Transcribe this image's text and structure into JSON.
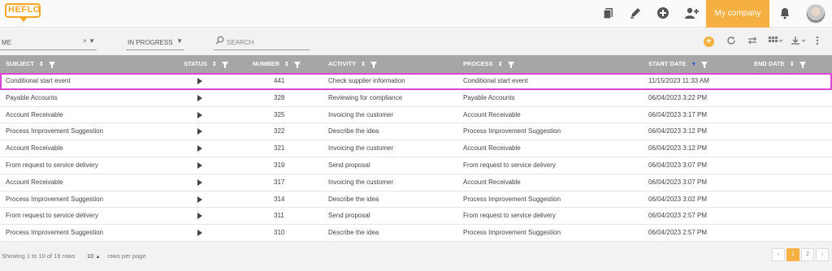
{
  "header": {
    "logo_text": "HEFLO",
    "company_label": "My company"
  },
  "filters": {
    "assignee_value": "ME",
    "assignee_clear": "×",
    "status_value": "IN PROGRESS",
    "search_placeholder": "SEARCH"
  },
  "table": {
    "columns": {
      "subject": "SUBJECT",
      "status": "STATUS",
      "number": "NUMBER",
      "activity": "ACTIVITY",
      "process": "PROCESS",
      "start_date": "START DATE",
      "end_date": "END DATE"
    },
    "rows": [
      {
        "subject": "Conditional start event",
        "number": "441",
        "activity": "Check supplier information",
        "process": "Conditional start event",
        "start_date": "11/15/2023 11:33 AM",
        "end_date": ""
      },
      {
        "subject": "Payable Accounts",
        "number": "328",
        "activity": "Reviewing for compliance",
        "process": "Payable Accounts",
        "start_date": "06/04/2023 3:22 PM",
        "end_date": ""
      },
      {
        "subject": "Account Receivable",
        "number": "325",
        "activity": "Invoicing the customer",
        "process": "Account Receivable",
        "start_date": "06/04/2023 3:17 PM",
        "end_date": ""
      },
      {
        "subject": "Process Improvement Suggestion",
        "number": "322",
        "activity": "Describe the idea",
        "process": "Process Improvement Suggestion",
        "start_date": "06/04/2023 3:12 PM",
        "end_date": ""
      },
      {
        "subject": "Account Receivable",
        "number": "321",
        "activity": "Invoicing the customer",
        "process": "Account Receivable",
        "start_date": "06/04/2023 3:12 PM",
        "end_date": ""
      },
      {
        "subject": "From request to service delivery",
        "number": "319",
        "activity": "Send proposal",
        "process": "From request to service delivery",
        "start_date": "06/04/2023 3:07 PM",
        "end_date": ""
      },
      {
        "subject": "Account Receivable",
        "number": "317",
        "activity": "Invoicing the customer",
        "process": "Account Receivable",
        "start_date": "06/04/2023 3:07 PM",
        "end_date": ""
      },
      {
        "subject": "Process Improvement Suggestion",
        "number": "314",
        "activity": "Describe the idea",
        "process": "Process Improvement Suggestion",
        "start_date": "06/04/2023 3:02 PM",
        "end_date": ""
      },
      {
        "subject": "From request to service delivery",
        "number": "311",
        "activity": "Send proposal",
        "process": "From request to service delivery",
        "start_date": "06/04/2023 2:57 PM",
        "end_date": ""
      },
      {
        "subject": "Process Improvement Suggestion",
        "number": "310",
        "activity": "Describe the idea",
        "process": "Process Improvement Suggestion",
        "start_date": "06/04/2023 2:57 PM",
        "end_date": ""
      }
    ]
  },
  "footer": {
    "showing_text": "Showing 1 to 10 of 19 rows",
    "page_size": "10",
    "rows_per_page": "rows per page",
    "pages": [
      "‹",
      "1",
      "2",
      "›"
    ],
    "current_page": "1"
  },
  "colors": {
    "accent": "#f5b041",
    "header_bg": "#a6a6a6",
    "selected_outline": "#d946d9"
  },
  "icons": [
    "copy-icon",
    "pencil-icon",
    "plus-circle-icon",
    "add-user-icon",
    "bell-icon",
    "refresh-icon",
    "filter-adjust-icon",
    "grid-view-icon",
    "download-icon",
    "more-vertical-icon",
    "search-icon"
  ]
}
